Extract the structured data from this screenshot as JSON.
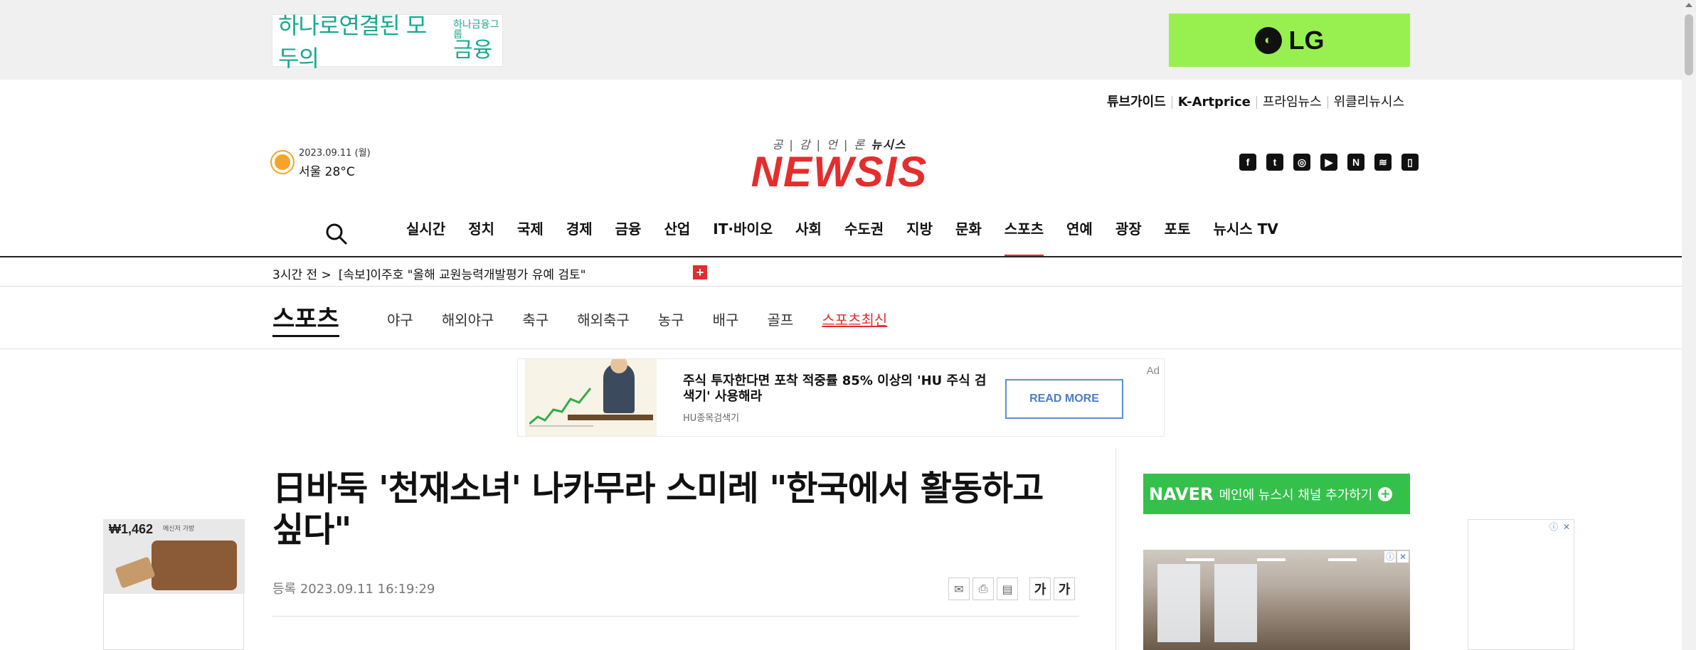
{
  "top_ads": {
    "hana": {
      "main": "하나로연결된 모두의",
      "group": "하나금융그룹",
      "finance": "금융"
    },
    "lg": {
      "logo_glyph": "LG",
      "text": "LG"
    }
  },
  "util_links": [
    "튜브가이드",
    "K-Artprice",
    "프라임뉴스",
    "위클리뉴시스"
  ],
  "weather": {
    "date": "2023.09.11 (월)",
    "temp": "서울 28°C"
  },
  "logo": {
    "tagline_1": "공 | 감 | 언 | 론 ",
    "tagline_2": "뉴시스",
    "name": "NEWSIS"
  },
  "social_icons": [
    "facebook-icon",
    "twitter-icon",
    "instagram-icon",
    "youtube-icon",
    "naver-icon",
    "rss-icon",
    "mobile-icon"
  ],
  "main_nav": [
    "실시간",
    "정치",
    "국제",
    "경제",
    "금융",
    "산업",
    "IT·바이오",
    "사회",
    "수도권",
    "지방",
    "문화",
    "스포츠",
    "연예",
    "광장",
    "포토",
    "뉴시스 TV"
  ],
  "main_nav_active": "스포츠",
  "breaking": {
    "time": "3시간 전 >",
    "text": "[속보]이주호 \"올해 교원능력개발평가 유예 검토\""
  },
  "section": {
    "title": "스포츠",
    "subnav": [
      "야구",
      "해외야구",
      "축구",
      "해외축구",
      "농구",
      "배구",
      "골프",
      "스포츠최신"
    ],
    "highlight": "스포츠최신"
  },
  "inline_ad": {
    "headline": "주식 투자한다면 포착 적중률 85% 이상의 'HU 주식 검색기' 사용해라",
    "source": "HU종목검색기",
    "button": "READ MORE",
    "label": "Ad"
  },
  "article": {
    "headline": "日바둑 '천재소녀' 나카무라 스미레 \"한국에서 활동하고 싶다\"",
    "date": "등록 2023.09.11 16:19:29",
    "tools": [
      "email-icon",
      "print-icon",
      "pdf-icon"
    ],
    "font_buttons": [
      "가",
      "가"
    ]
  },
  "naver_banner": {
    "brand": "NAVER",
    "message": "메인에 뉴스시 채널 추가하기"
  },
  "left_ad": {
    "price": "₩1,462",
    "sub": "메신저 가방"
  },
  "colors": {
    "brand_red": "#e42d2d",
    "lg_green": "#98f050",
    "naver_green": "#35c04b",
    "hana_teal": "#1aa88f"
  }
}
